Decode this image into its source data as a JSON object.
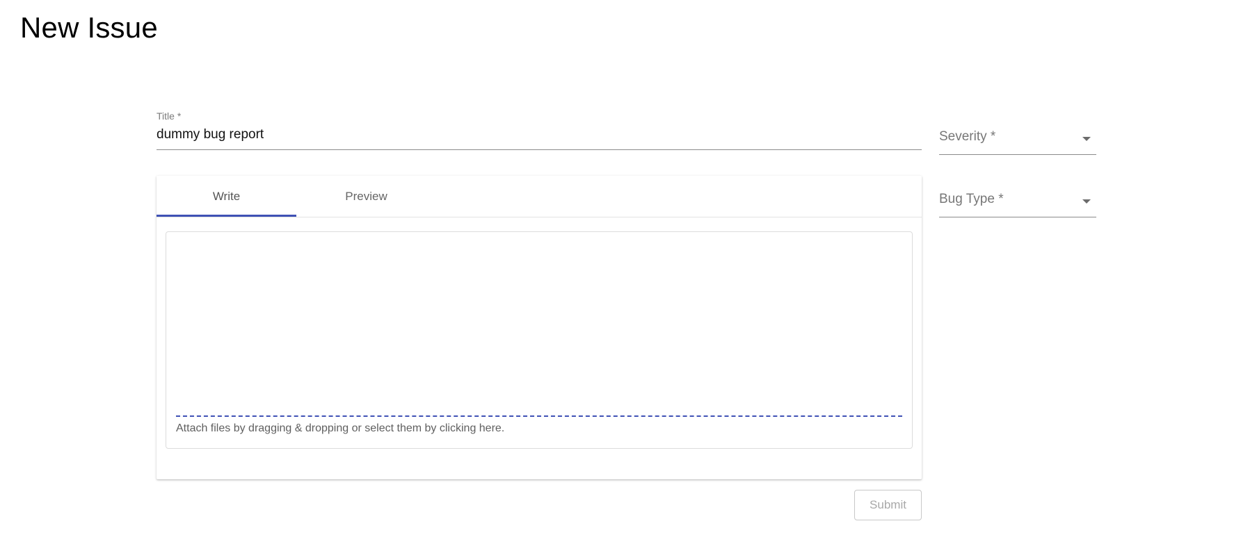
{
  "page": {
    "title": "New Issue"
  },
  "form": {
    "title_field": {
      "label": "Title *",
      "value": "dummy bug report"
    },
    "severity": {
      "label": "Severity *",
      "selected": ""
    },
    "bug_type": {
      "label": "Bug Type *",
      "selected": ""
    },
    "editor": {
      "tabs": [
        {
          "label": "Write",
          "active": true
        },
        {
          "label": "Preview",
          "active": false
        }
      ],
      "body": "",
      "attach_hint": "Attach files by dragging & dropping or select them by clicking here."
    },
    "submit_label": "Submit",
    "submit_disabled": true
  },
  "colors": {
    "accent": "#3f51b5",
    "muted_text": "#777777",
    "disabled_text": "#a8a8a8"
  }
}
